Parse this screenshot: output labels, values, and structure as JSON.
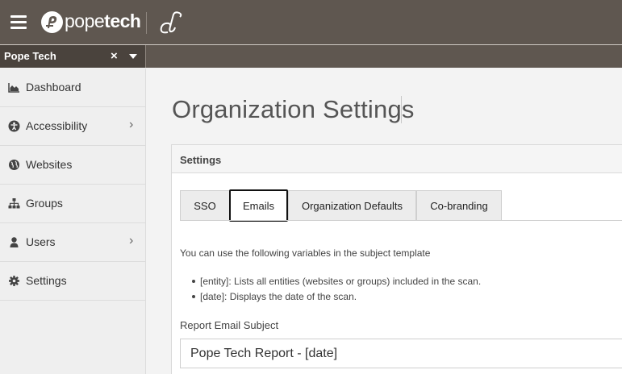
{
  "header": {
    "brand_light": "pope",
    "brand_bold": "tech",
    "menu_icon": "hamburger-icon"
  },
  "org_selector": {
    "selected": "Pope Tech",
    "clear_label": "×"
  },
  "sidebar": {
    "items": [
      {
        "label": "Dashboard",
        "icon": "area-chart-icon",
        "has_submenu": false
      },
      {
        "label": "Accessibility",
        "icon": "universal-access-icon",
        "has_submenu": true
      },
      {
        "label": "Websites",
        "icon": "globe-icon",
        "has_submenu": false
      },
      {
        "label": "Groups",
        "icon": "sitemap-icon",
        "has_submenu": false
      },
      {
        "label": "Users",
        "icon": "user-icon",
        "has_submenu": true
      },
      {
        "label": "Settings",
        "icon": "gear-icon",
        "has_submenu": false
      }
    ],
    "chevron": "›"
  },
  "main": {
    "title": "Organization Settings",
    "panel": {
      "title": "Settings",
      "tabs": [
        {
          "label": "SSO",
          "active": false
        },
        {
          "label": "Emails",
          "active": true
        },
        {
          "label": "Organization Defaults",
          "active": false
        },
        {
          "label": "Co-branding",
          "active": false
        }
      ],
      "help_text": "You can use the following variables in the subject template",
      "variables": [
        "[entity]: Lists all entities (websites or groups) included in the scan.",
        "[date]: Displays the date of the scan."
      ],
      "subject_label": "Report Email Subject",
      "subject_value": "Pope Tech Report - [date]"
    }
  },
  "colors": {
    "header_bg": "#5f5750",
    "org_select_bg": "#4a433d",
    "sidebar_bg": "#efefef",
    "active_tab_border": "#111111"
  }
}
